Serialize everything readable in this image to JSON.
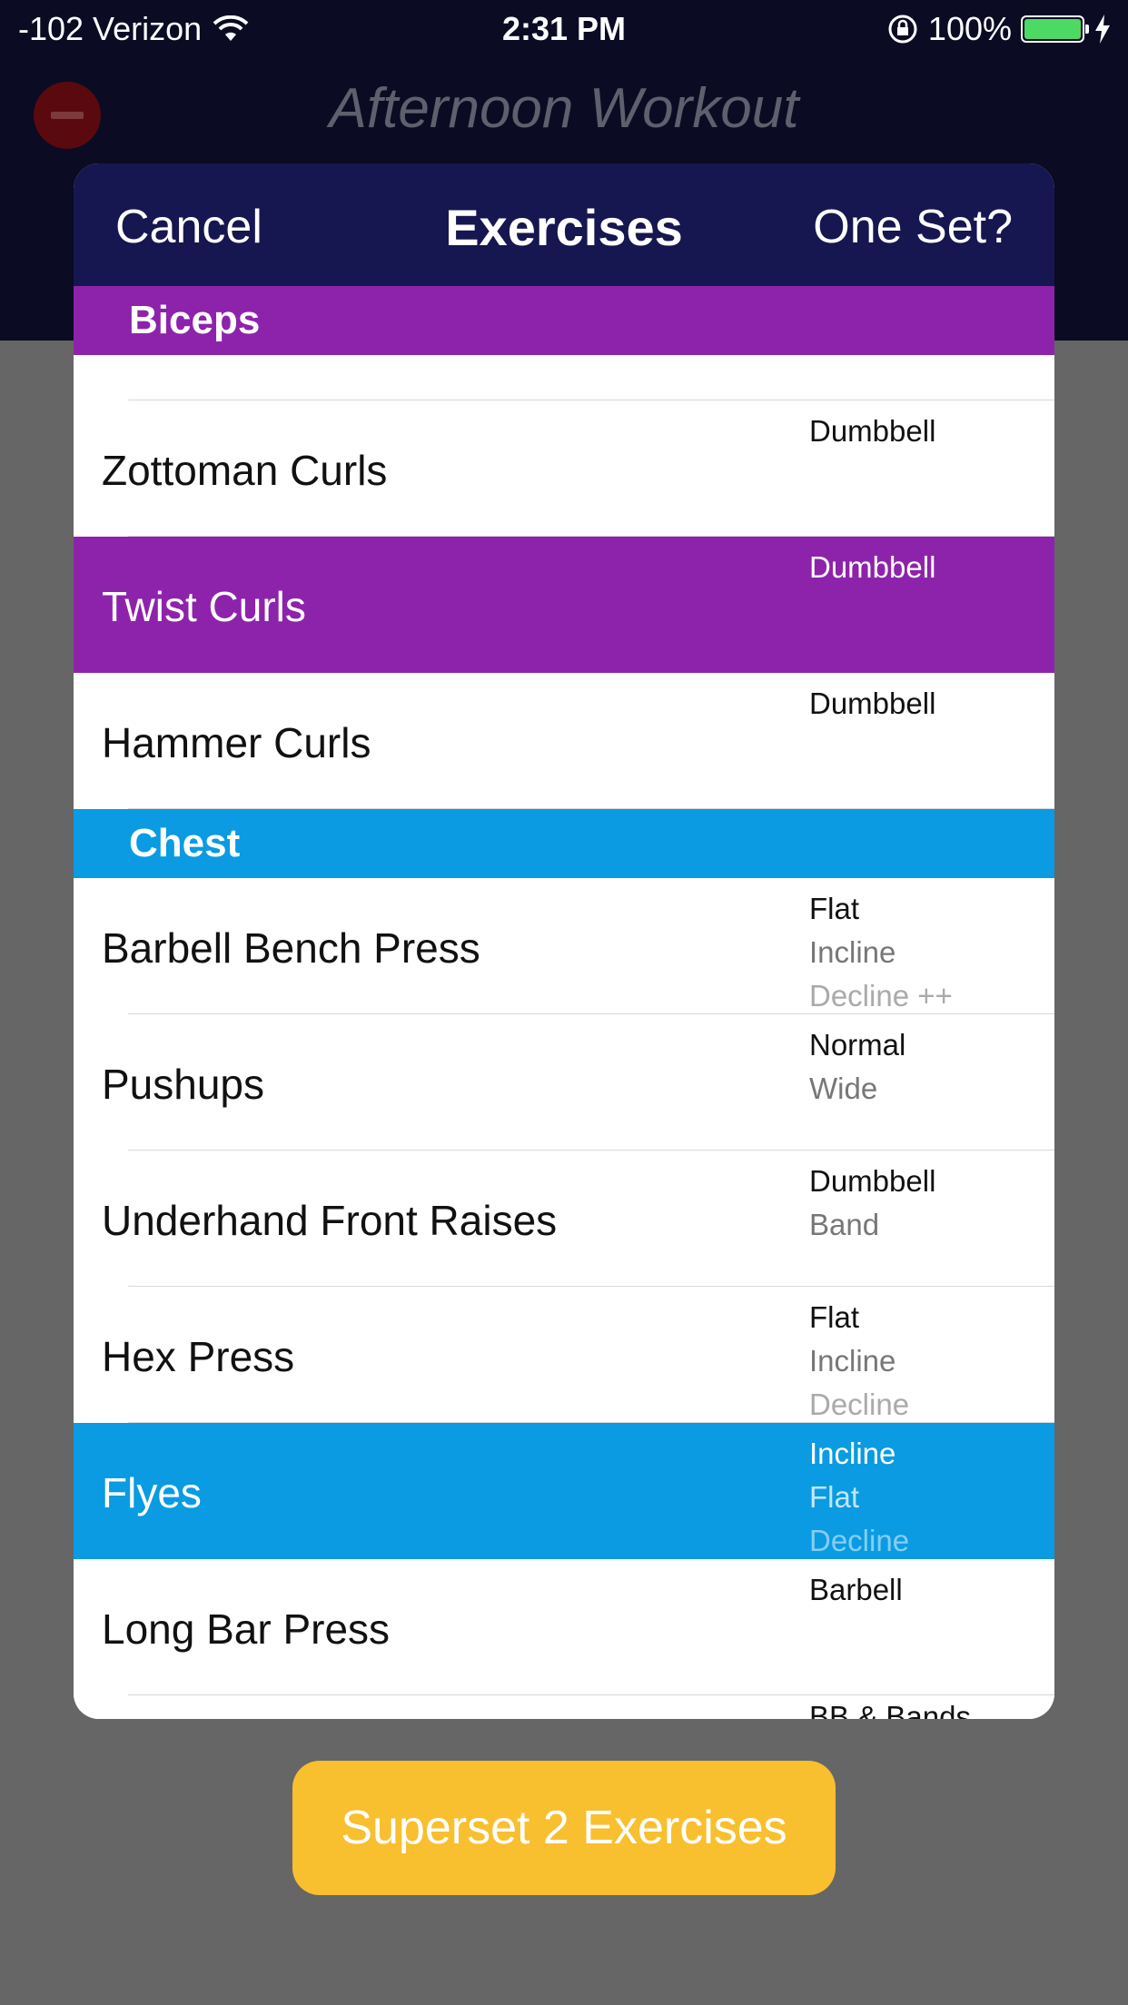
{
  "status_bar": {
    "carrier": "-102 Verizon",
    "time": "2:31 PM",
    "battery": "100%"
  },
  "background": {
    "title": "Afternoon Workout"
  },
  "modal": {
    "cancel_label": "Cancel",
    "title": "Exercises",
    "one_set_label": "One Set?"
  },
  "sections": [
    {
      "name": "Biceps",
      "rows": [
        {
          "name": "Zottoman Curls",
          "options": [
            "Dumbbell"
          ],
          "selected": false
        },
        {
          "name": "Twist Curls",
          "options": [
            "Dumbbell"
          ],
          "selected": true
        },
        {
          "name": "Hammer Curls",
          "options": [
            "Dumbbell"
          ],
          "selected": false
        }
      ]
    },
    {
      "name": "Chest",
      "rows": [
        {
          "name": "Barbell Bench Press",
          "options": [
            "Flat",
            "Incline",
            "Decline ++"
          ],
          "selected": false
        },
        {
          "name": "Pushups",
          "options": [
            "Normal",
            "Wide"
          ],
          "selected": false
        },
        {
          "name": "Underhand Front Raises",
          "options": [
            "Dumbbell",
            "Band"
          ],
          "selected": false
        },
        {
          "name": "Hex Press",
          "options": [
            "Flat",
            "Incline",
            "Decline"
          ],
          "selected": false
        },
        {
          "name": "Flyes",
          "options": [
            "Incline",
            "Flat",
            "Decline"
          ],
          "selected": true
        },
        {
          "name": "Long Bar Press",
          "options": [
            "Barbell"
          ],
          "selected": false
        },
        {
          "name": "",
          "options": [
            "BB & Bands"
          ],
          "selected": false
        }
      ]
    }
  ],
  "superset_button": "Superset 2 Exercises",
  "colors": {
    "biceps_accent": "#8d23ab",
    "chest_accent": "#0a9be2",
    "modal_header": "#161650",
    "superset_button": "#f8bf2f"
  }
}
